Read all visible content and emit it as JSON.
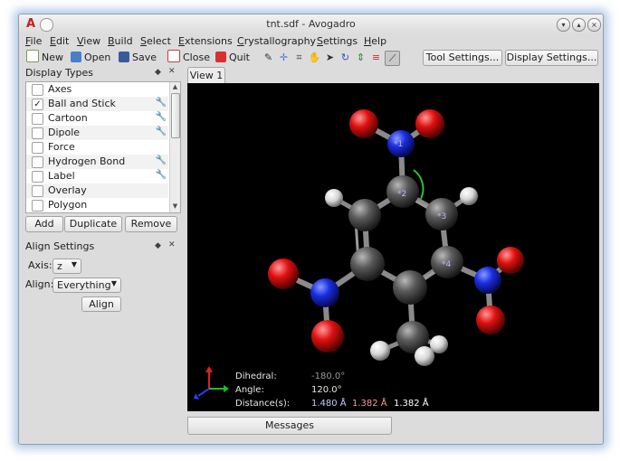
{
  "window": {
    "title": "tnt.sdf - Avogadro"
  },
  "menu": [
    "File",
    "Edit",
    "View",
    "Build",
    "Select",
    "Extensions",
    "Crystallography",
    "Settings",
    "Help"
  ],
  "toolbar": {
    "new": "New",
    "open": "Open",
    "save": "Save",
    "close": "Close",
    "quit": "Quit",
    "tool_settings": "Tool Settings...",
    "display_settings": "Display Settings..."
  },
  "display_types": {
    "title": "Display Types",
    "items": [
      {
        "label": "Axes",
        "checked": "",
        "wrench": ""
      },
      {
        "label": "Ball and Stick",
        "checked": "✓",
        "wrench": "🔧"
      },
      {
        "label": "Cartoon",
        "checked": "",
        "wrench": "🔧"
      },
      {
        "label": "Dipole",
        "checked": "",
        "wrench": "🔧"
      },
      {
        "label": "Force",
        "checked": "",
        "wrench": ""
      },
      {
        "label": "Hydrogen Bond",
        "checked": "",
        "wrench": "🔧"
      },
      {
        "label": "Label",
        "checked": "",
        "wrench": "🔧"
      },
      {
        "label": "Overlay",
        "checked": "",
        "wrench": ""
      },
      {
        "label": "Polygon",
        "checked": "",
        "wrench": ""
      }
    ],
    "add": "Add",
    "duplicate": "Duplicate",
    "remove": "Remove"
  },
  "align_settings": {
    "title": "Align Settings",
    "axis_label": "Axis:",
    "axis_value": "z",
    "align_label": "Align:",
    "align_value": "Everything",
    "align_button": "Align"
  },
  "view": {
    "tab": "View 1",
    "atom_labels": [
      "*1",
      "*2",
      "*3",
      "*4"
    ],
    "measure": {
      "dihedral_label": "Dihedral:",
      "dihedral_value": "-180.0°",
      "angle_label": "Angle:",
      "angle_value": "120.0°",
      "distance_label": "Distance(s):",
      "distances": [
        "1.480 Å",
        "1.382 Å",
        "1.382 Å"
      ]
    },
    "colors": {
      "carbon": "#5a5a5a",
      "nitrogen": "#1a2ee0",
      "oxygen": "#e01010",
      "hydrogen": "#e6e6e6",
      "dist1": "#c8c8ff",
      "dist2": "#ff9a9a",
      "dist3": "#ffffff"
    }
  },
  "messages": {
    "tab": "Messages"
  }
}
